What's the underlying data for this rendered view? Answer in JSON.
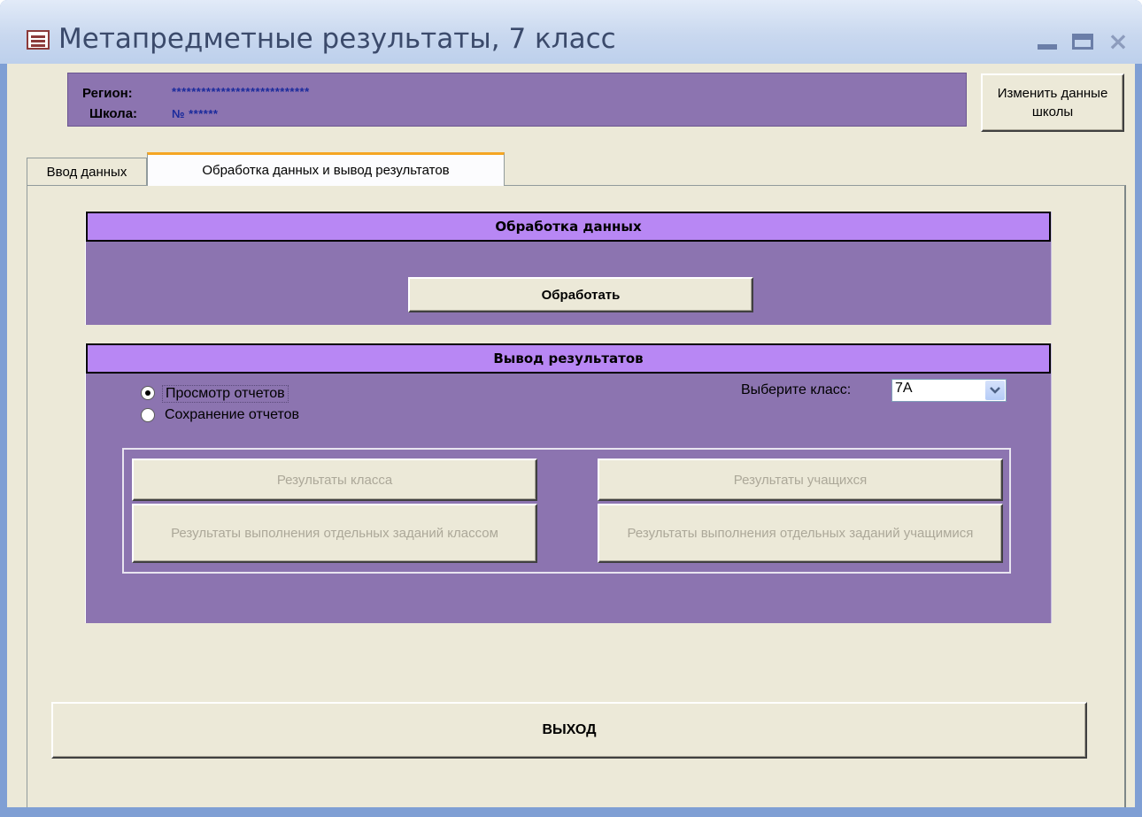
{
  "window": {
    "title": "Метапредметные результаты, 7 класс"
  },
  "title_buttons": {
    "minimize": "minimize-icon",
    "maximize": "maximize-icon",
    "close": "×"
  },
  "header": {
    "region_label": "Регион:",
    "region_value": "****************************",
    "school_label": "Школа:",
    "school_value": "№ ******",
    "change_school_button": "Изменить данные школы"
  },
  "tabs": [
    {
      "label": "Ввод данных",
      "active": false
    },
    {
      "label": "Обработка данных и вывод результатов",
      "active": true
    }
  ],
  "processing": {
    "title": "Обработка данных",
    "process_button": "Обработать"
  },
  "output": {
    "title": "Вывод результатов",
    "options": [
      {
        "label": "Просмотр отчетов",
        "checked": true
      },
      {
        "label": "Сохранение отчетов",
        "checked": false
      }
    ],
    "class_select_label": "Выберите класс:",
    "class_select_value": "7А",
    "report_buttons": [
      "Результаты класса",
      "Результаты учащихся",
      "Результаты выполнения отдельных заданий классом",
      "Результаты выполнения отдельных заданий учащимися"
    ]
  },
  "exit_button": "ВЫХОД",
  "colors": {
    "section_background": "#8c74b0",
    "section_header": "#b887f4",
    "form_background": "#ece9d8",
    "active_tab_accent": "#f5a623"
  }
}
